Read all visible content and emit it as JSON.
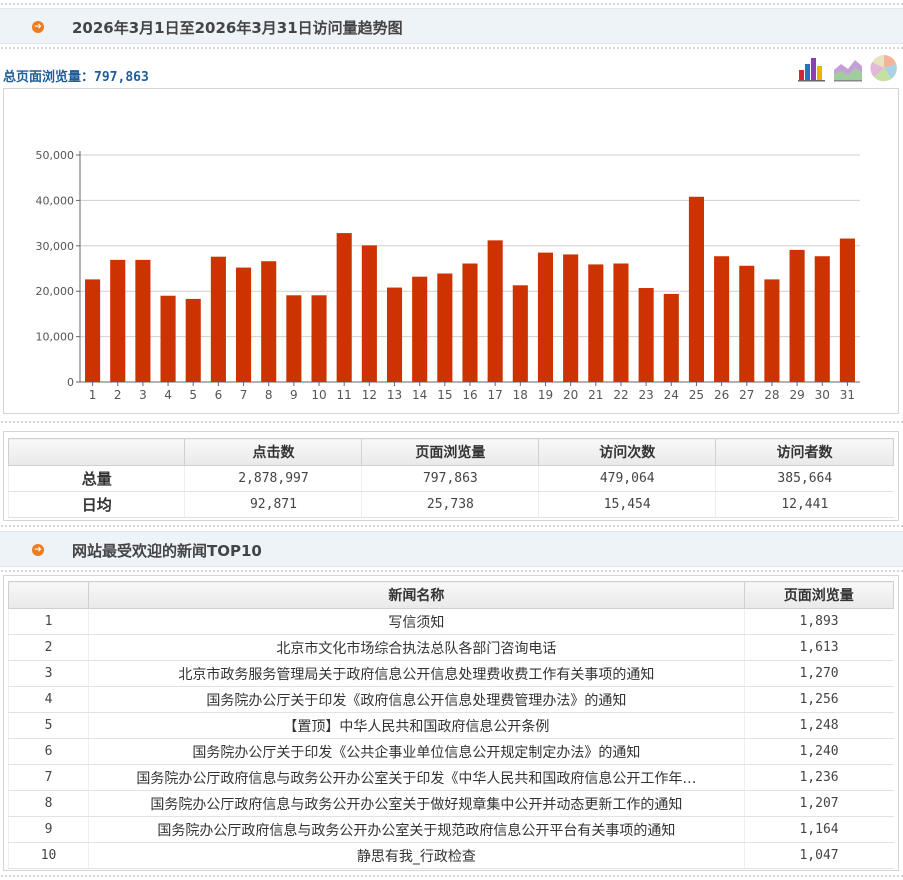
{
  "trend": {
    "title": "2026年3月1日至2026年3月31日访问量趋势图",
    "total_label": "总页面浏览量：",
    "total_value": "797,863",
    "icons": [
      "bar-chart-icon",
      "area-chart-icon",
      "pie-chart-icon"
    ]
  },
  "chart_data": {
    "type": "bar",
    "categories": [
      "1",
      "2",
      "3",
      "4",
      "5",
      "6",
      "7",
      "8",
      "9",
      "10",
      "11",
      "12",
      "13",
      "14",
      "15",
      "16",
      "17",
      "18",
      "19",
      "20",
      "21",
      "22",
      "23",
      "24",
      "25",
      "26",
      "27",
      "28",
      "29",
      "30",
      "31"
    ],
    "values": [
      22600,
      26900,
      26900,
      19000,
      18300,
      27600,
      25200,
      26600,
      19100,
      19100,
      32800,
      30100,
      20800,
      23200,
      23900,
      26100,
      31200,
      21300,
      28500,
      28100,
      25900,
      26100,
      20700,
      19400,
      40800,
      27700,
      25600,
      22600,
      29100,
      27700,
      31600
    ],
    "yticks": [
      "0",
      "10,000",
      "20,000",
      "30,000",
      "40,000",
      "50,000"
    ],
    "ylim": [
      0,
      50000
    ],
    "grid": true,
    "bar_color": "#cc3300"
  },
  "stats": {
    "headers": [
      "",
      "点击数",
      "页面浏览量",
      "访问次数",
      "访问者数"
    ],
    "rows": [
      {
        "label": "总量",
        "values": [
          "2,878,997",
          "797,863",
          "479,064",
          "385,664"
        ]
      },
      {
        "label": "日均",
        "values": [
          "92,871",
          "25,738",
          "15,454",
          "12,441"
        ]
      }
    ]
  },
  "top10": {
    "title": "网站最受欢迎的新闻TOP10",
    "headers": [
      "",
      "新闻名称",
      "页面浏览量"
    ],
    "rows": [
      {
        "rank": "1",
        "name": "写信须知",
        "views": "1,893"
      },
      {
        "rank": "2",
        "name": "北京市文化市场综合执法总队各部门咨询电话",
        "views": "1,613"
      },
      {
        "rank": "3",
        "name": "北京市政务服务管理局关于政府信息公开信息处理费收费工作有关事项的通知",
        "views": "1,270"
      },
      {
        "rank": "4",
        "name": "国务院办公厅关于印发《政府信息公开信息处理费管理办法》的通知",
        "views": "1,256"
      },
      {
        "rank": "5",
        "name": "【置顶】中华人民共和国政府信息公开条例",
        "views": "1,248"
      },
      {
        "rank": "6",
        "name": "国务院办公厅关于印发《公共企事业单位信息公开规定制定办法》的通知",
        "views": "1,240"
      },
      {
        "rank": "7",
        "name": "国务院办公厅政府信息与政务公开办公室关于印发《中华人民共和国政府信息公开工作年…",
        "views": "1,236"
      },
      {
        "rank": "8",
        "name": "国务院办公厅政府信息与政务公开办公室关于做好规章集中公开并动态更新工作的通知",
        "views": "1,207"
      },
      {
        "rank": "9",
        "name": "国务院办公厅政府信息与政务公开办公室关于规范政府信息公开平台有关事项的通知",
        "views": "1,164"
      },
      {
        "rank": "10",
        "name": "静思有我_行政检查",
        "views": "1,047"
      }
    ]
  }
}
